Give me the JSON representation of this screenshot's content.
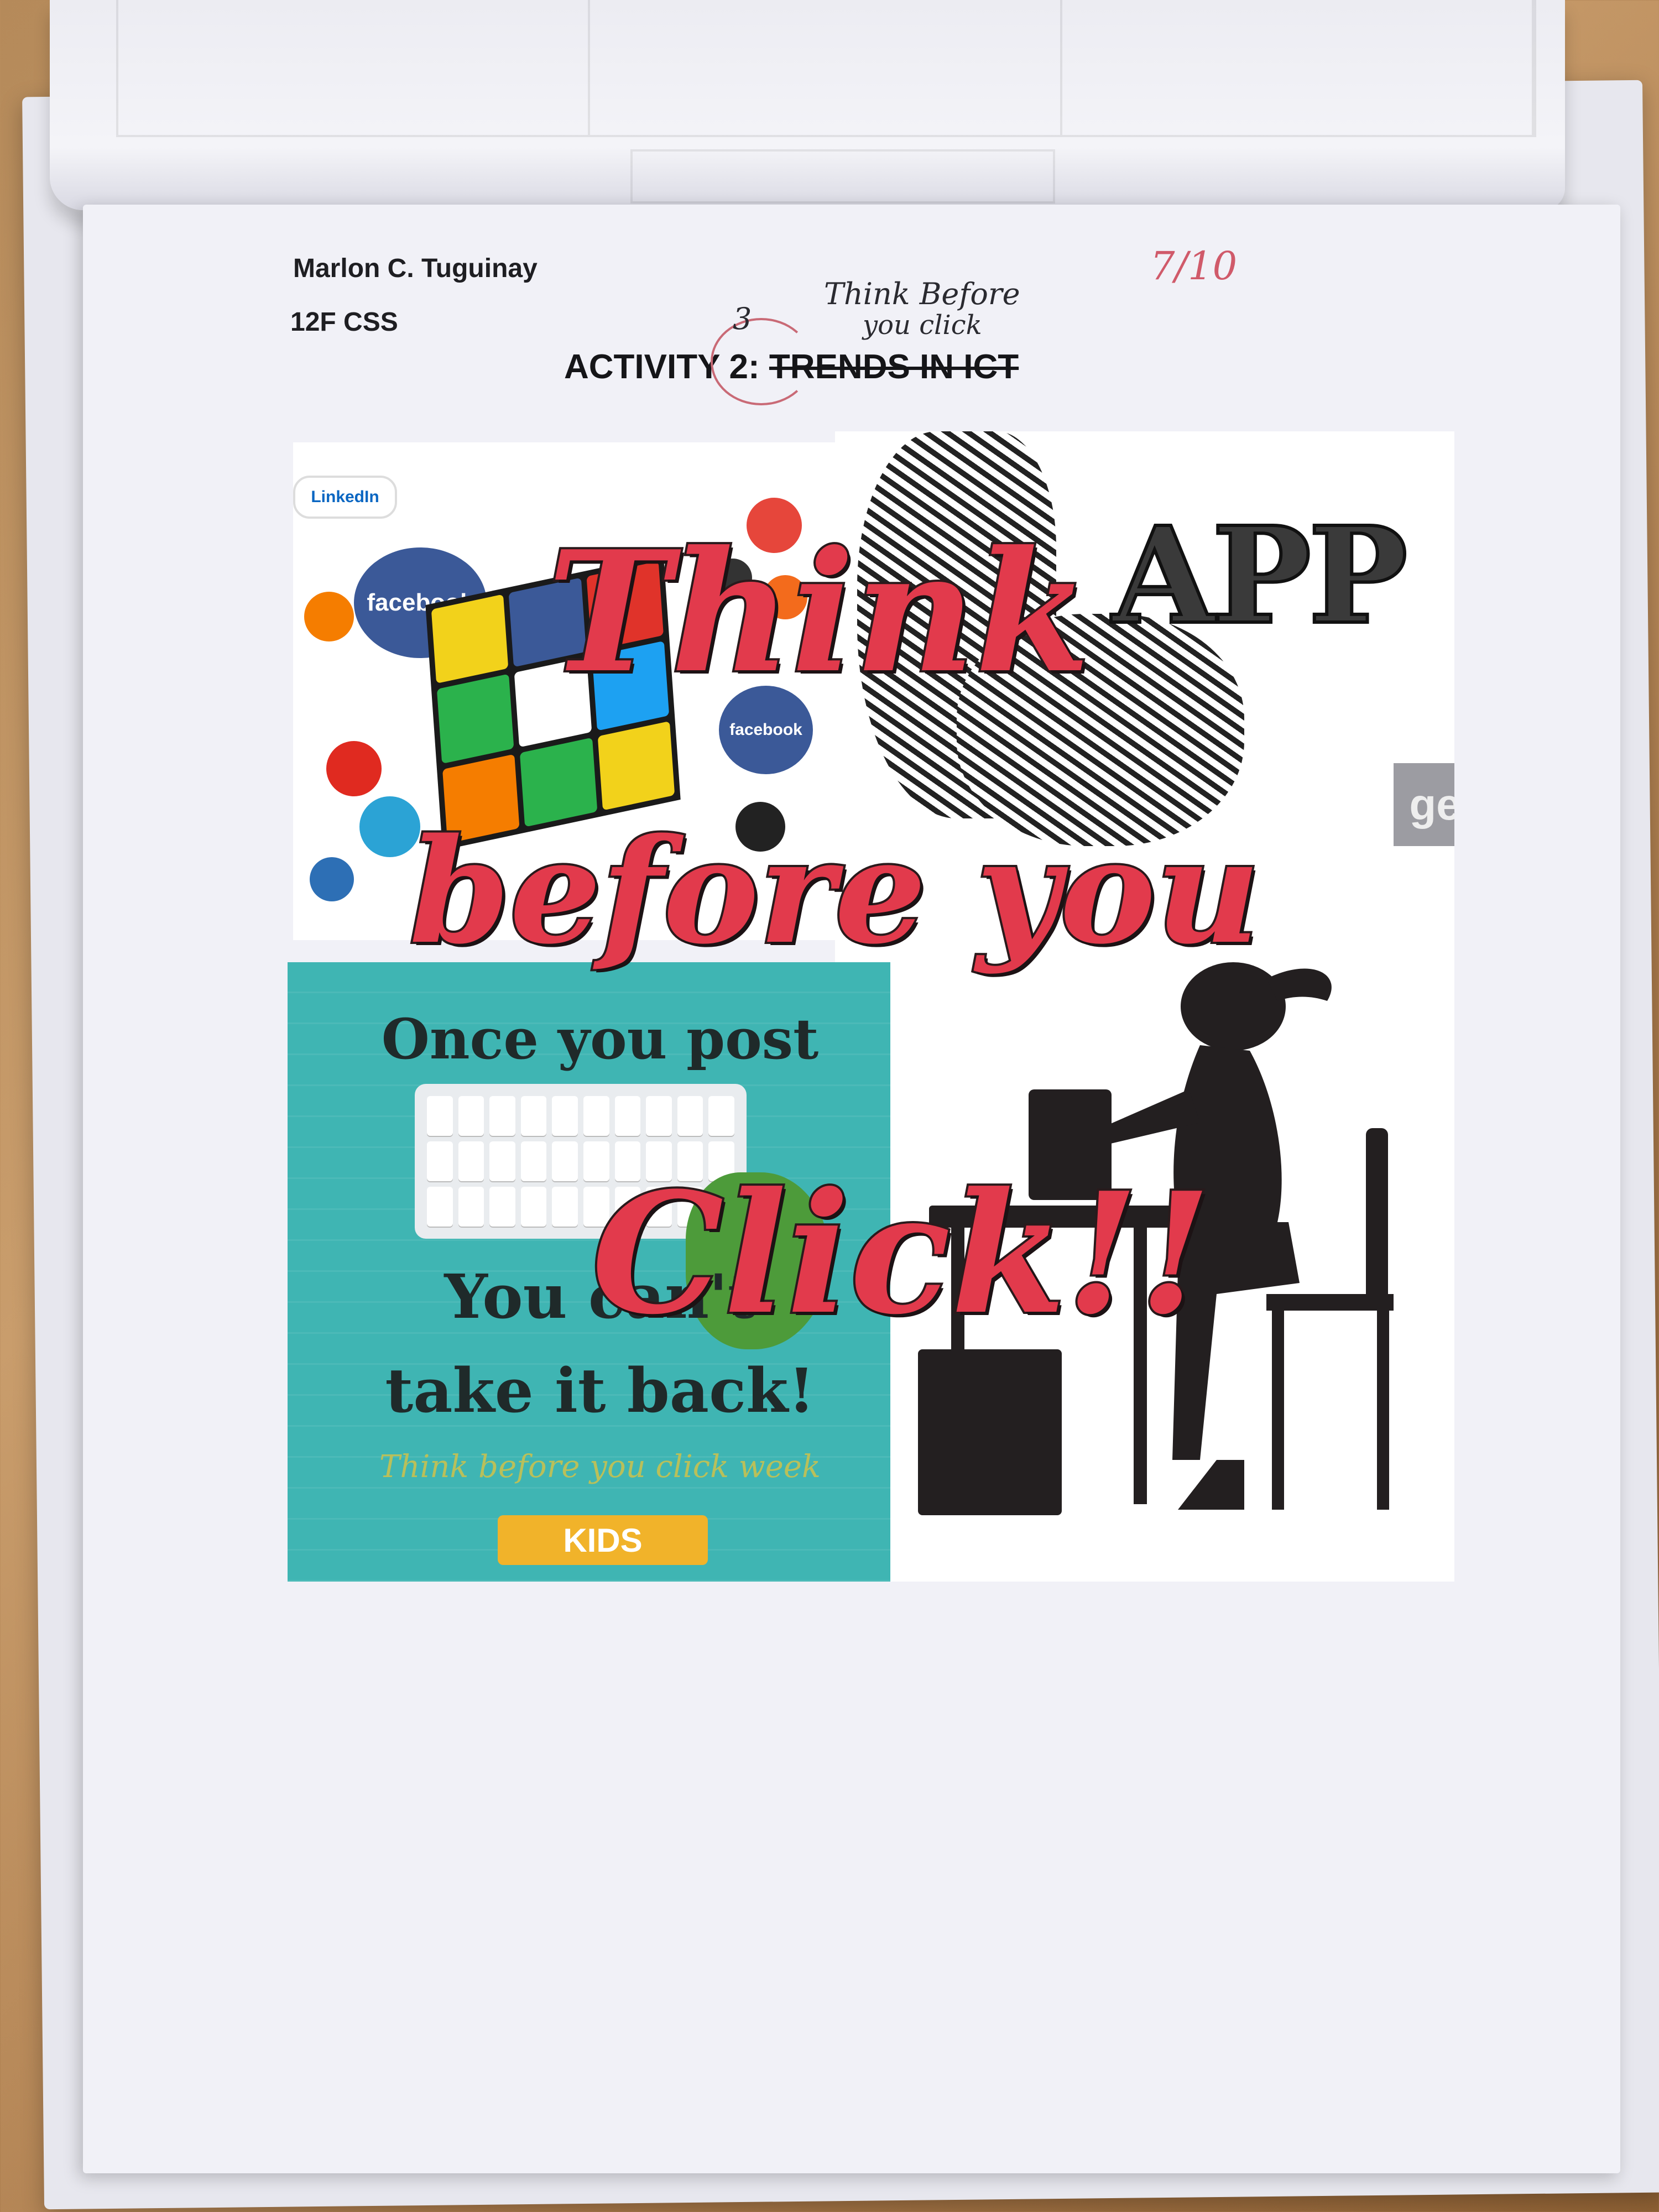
{
  "sheet": {
    "author": "Marlon C. Tuguinay",
    "section": "12F CSS",
    "title_prefix": "ACTIVITY 2:",
    "title_struck": "TRENDS IN ICT"
  },
  "handwriting": {
    "number": "3",
    "line1": "Think  Before",
    "line2": "you  click",
    "grade": "7/10"
  },
  "collage": {
    "social_labels": [
      "LinkedIn",
      "facebook",
      "facebook"
    ],
    "app_text": "APP",
    "side_box_text": "ge",
    "poster": {
      "line1": "Once you post",
      "line2": "You can't",
      "line3": "take it back!",
      "line4": "Think before you click week",
      "badge": "KIDS"
    },
    "overlay": [
      "Think",
      "before you",
      "Click!!"
    ]
  },
  "colors": {
    "overlay_red": "#e23a4c",
    "teal": "#3fb5b3",
    "grade_ink": "#d05a6a"
  }
}
